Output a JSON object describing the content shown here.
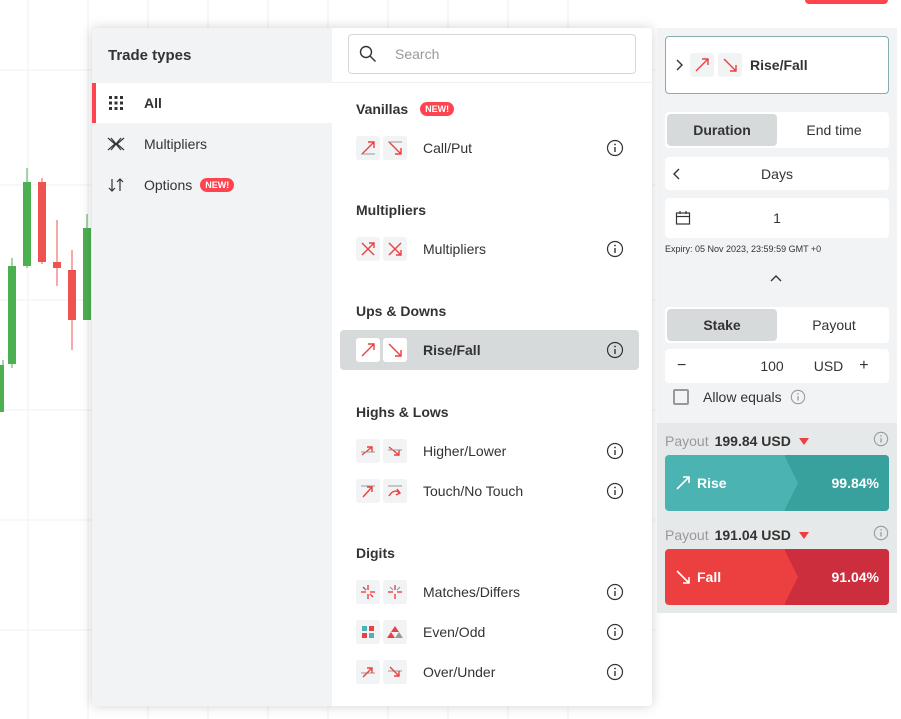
{
  "modal": {
    "title": "Trade types",
    "categories": [
      {
        "label": "All"
      },
      {
        "label": "Multipliers"
      },
      {
        "label": "Options",
        "badge": "NEW!"
      }
    ],
    "search_placeholder": "Search",
    "groups": [
      {
        "title": "Vanillas",
        "badge": "NEW!",
        "items": [
          {
            "label": "Call/Put"
          }
        ]
      },
      {
        "title": "Multipliers",
        "items": [
          {
            "label": "Multipliers"
          }
        ]
      },
      {
        "title": "Ups & Downs",
        "items": [
          {
            "label": "Rise/Fall"
          }
        ]
      },
      {
        "title": "Highs & Lows",
        "items": [
          {
            "label": "Higher/Lower"
          },
          {
            "label": "Touch/No Touch"
          }
        ]
      },
      {
        "title": "Digits",
        "items": [
          {
            "label": "Matches/Differs"
          },
          {
            "label": "Even/Odd"
          },
          {
            "label": "Over/Under"
          }
        ]
      }
    ]
  },
  "sidebar": {
    "trade_type": "Rise/Fall",
    "duration_tabs": [
      "Duration",
      "End time"
    ],
    "duration_unit": "Days",
    "duration_value": "1",
    "expiry": "Expiry: 05 Nov 2023, 23:59:59 GMT +0",
    "stake_tabs": [
      "Stake",
      "Payout"
    ],
    "stake_value": "100",
    "currency": "USD",
    "allow_equals": "Allow equals",
    "payout_label": "Payout",
    "rise": {
      "payout": "199.84 USD",
      "label": "Rise",
      "percent": "99.84%"
    },
    "fall": {
      "payout": "191.04 USD",
      "label": "Fall",
      "percent": "91.04%"
    }
  },
  "colors": {
    "accent_red": "#ff444f",
    "rise_teal": "#4bb4b3",
    "fall_red": "#ec3f3f"
  }
}
